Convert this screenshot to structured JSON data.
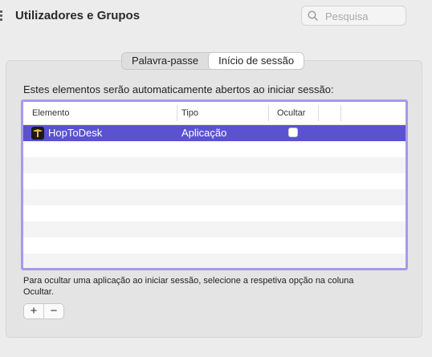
{
  "window": {
    "title": "Utilizadores e Grupos"
  },
  "search": {
    "placeholder": "Pesquisa",
    "value": ""
  },
  "tabs": [
    {
      "label": "Palavra-passe",
      "active": false
    },
    {
      "label": "Início de sessão",
      "active": true
    }
  ],
  "login_items": {
    "intro": "Estes elementos serão automaticamente abertos ao iniciar sessão:",
    "columns": [
      "Elemento",
      "Tipo",
      "Ocultar"
    ],
    "rows": [
      {
        "name": "HopToDesk",
        "type": "Aplicação",
        "hidden": false,
        "icon": "hoptodesk-app-icon",
        "selected": true
      }
    ],
    "footnote": "Para ocultar uma aplicação ao iniciar sessão, selecione a respetiva opção na coluna Ocultar.",
    "add_label": "+",
    "remove_label": "−"
  },
  "colors": {
    "selection": "#5b52d0",
    "focus_ring": "#a79ae8"
  }
}
